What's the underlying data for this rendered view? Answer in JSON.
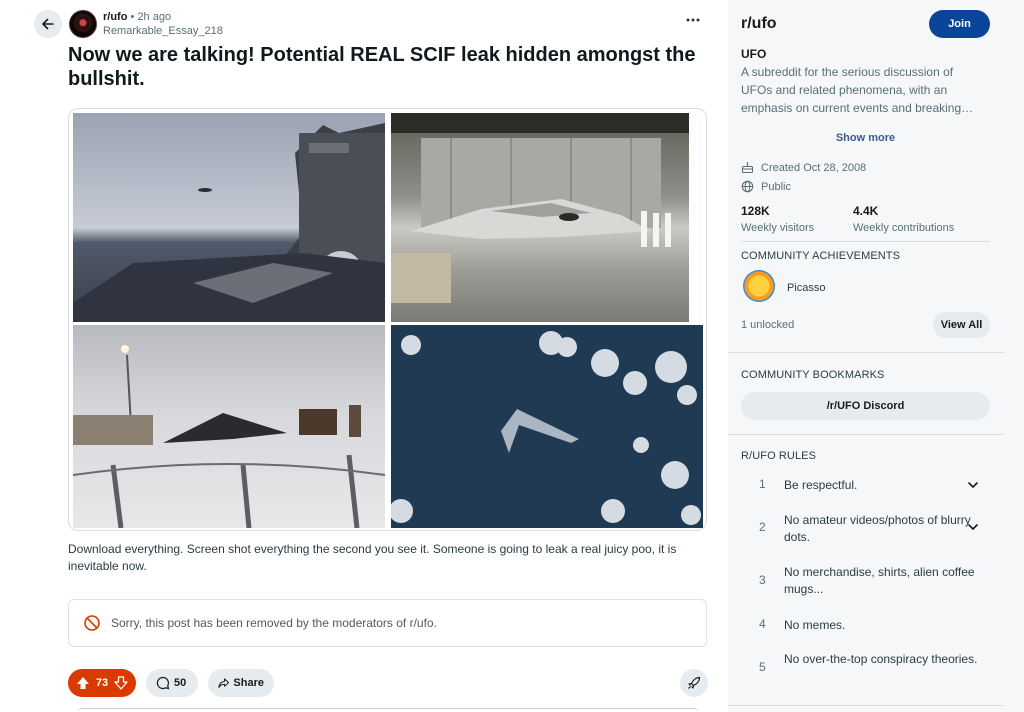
{
  "post": {
    "subreddit": "r/ufo",
    "separator": "•",
    "time": "2h ago",
    "author": "Remarkable_Essay_218",
    "title": "Now we are talking! Potential REAL SCIF leak hidden amongst the bullshit.",
    "body": "Download everything. Screen shot everything the second you see it. Someone is going to leak a real juicy poo, it is inevitable now.",
    "removed_notice": "Sorry, this post has been removed by the moderators of r/ufo.",
    "votes": "73",
    "comments": "50",
    "share_label": "Share"
  },
  "icons": {
    "back": "arrow-left-icon",
    "more": "ellipsis-icon",
    "ban": "ban-icon",
    "upvote": "upvote-arrow-icon",
    "downvote": "downvote-arrow-icon",
    "comment": "comment-bubble-icon",
    "share": "share-arrow-icon",
    "award": "rocket-award-icon"
  },
  "sidebar": {
    "name": "r/ufo",
    "join_label": "Join",
    "title": "UFO",
    "description": "A subreddit for the serious discussion of UFOs and related phenomena, with an emphasis on current events and breaking…",
    "show_more": "Show more",
    "created": "Created Oct 28, 2008",
    "visibility": "Public",
    "stats": [
      {
        "value": "128K",
        "label": "Weekly visitors"
      },
      {
        "value": "4.4K",
        "label": "Weekly contributions"
      }
    ],
    "achievements_heading": "COMMUNITY ACHIEVEMENTS",
    "achievement_name": "Picasso",
    "unlocked": "1 unlocked",
    "view_all": "View All",
    "bookmarks_heading": "COMMUNITY BOOKMARKS",
    "bookmark": "/r/UFO Discord",
    "rules_heading": "R/UFO RULES",
    "rules": [
      {
        "num": "1",
        "text": "Be respectful."
      },
      {
        "num": "2",
        "text": "No amateur videos/photos of blurry dots."
      },
      {
        "num": "3",
        "text": "No merchandise, shirts, alien coffee mugs..."
      },
      {
        "num": "4",
        "text": "No memes."
      },
      {
        "num": "5",
        "text": "No over-the-top conspiracy theories."
      }
    ]
  },
  "colors": {
    "vote_bg": "#d93a00",
    "join_bg": "#0a449b",
    "pill_bg": "#e5ebee"
  }
}
